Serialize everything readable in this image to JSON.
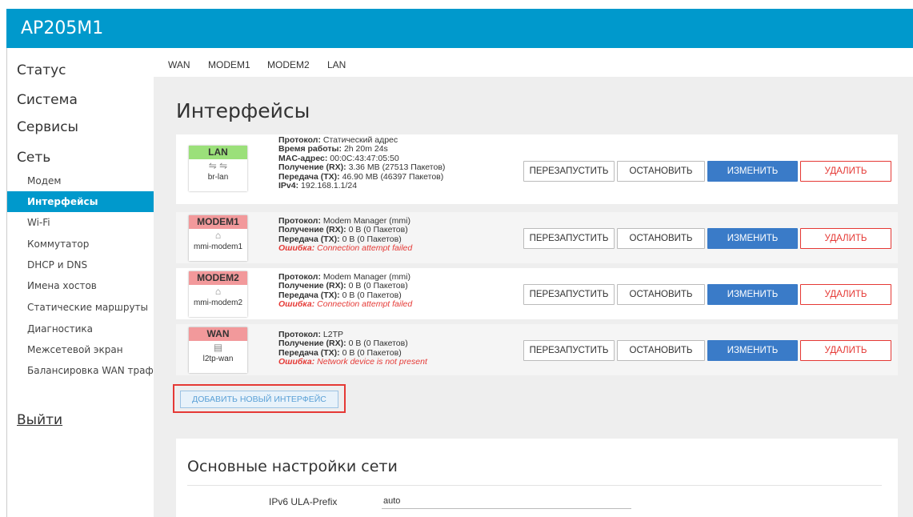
{
  "app_title": "AP205M1",
  "sidebar": {
    "main": [
      {
        "label": "Статус"
      },
      {
        "label": "Система"
      },
      {
        "label": "Сервисы"
      },
      {
        "label": "Сеть"
      }
    ],
    "sub": [
      {
        "label": "Модем"
      },
      {
        "label": "Интерфейсы"
      },
      {
        "label": "Wi-Fi"
      },
      {
        "label": "Коммутатор"
      },
      {
        "label": "DHCP и DNS"
      },
      {
        "label": "Имена хостов"
      },
      {
        "label": "Статические маршруты"
      },
      {
        "label": "Диагностика"
      },
      {
        "label": "Межсетевой экран"
      },
      {
        "label": "Балансировка WAN трафика"
      }
    ],
    "logout": "Выйти"
  },
  "tabs": [
    "WAN",
    "MODEM1",
    "MODEM2",
    "LAN"
  ],
  "page_title": "Интерфейсы",
  "labels": {
    "protocol": "Протокол:",
    "uptime": "Время работы:",
    "mac": "MAC-адрес:",
    "rx": "Получение (RX):",
    "tx": "Передача (TX):",
    "ipv4": "IPv4:",
    "error": "Ошибка:"
  },
  "buttons": {
    "restart": "ПЕРЕЗАПУСТИТЬ",
    "stop": "ОСТАНОВИТЬ",
    "edit": "ИЗМЕНИТЬ",
    "delete": "УДАЛИТЬ"
  },
  "interfaces": [
    {
      "name": "LAN",
      "color": "#9be07a",
      "icon": "bridge-icon",
      "device": "br-lan",
      "protocol": "Статический адрес",
      "uptime": "2h 20m 24s",
      "mac": "00:0C:43:47:05:50",
      "rx": "3.36 MB (27513 Пакетов)",
      "tx": "46.90 MB (46397 Пакетов)",
      "ipv4": "192.168.1.1/24"
    },
    {
      "name": "MODEM1",
      "color": "#f2999b",
      "icon": "ethernet-icon",
      "device": "mmi-modem1",
      "protocol": "Modem Manager (mmi)",
      "rx": "0 B (0 Пакетов)",
      "tx": "0 B (0 Пакетов)",
      "error": "Connection attempt failed"
    },
    {
      "name": "MODEM2",
      "color": "#f2999b",
      "icon": "ethernet-icon",
      "device": "mmi-modem2",
      "protocol": "Modem Manager (mmi)",
      "rx": "0 B (0 Пакетов)",
      "tx": "0 B (0 Пакетов)",
      "error": "Connection attempt failed"
    },
    {
      "name": "WAN",
      "color": "#f2999b",
      "icon": "tunnel-icon",
      "device": "l2tp-wan",
      "protocol": "L2TP",
      "rx": "0 B (0 Пакетов)",
      "tx": "0 B (0 Пакетов)",
      "error": "Network device is not present"
    }
  ],
  "add_button": "ДОБАВИТЬ НОВЫЙ ИНТЕРФЕЙС",
  "global": {
    "title": "Основные настройки сети",
    "ipv6_label": "IPv6 ULA-Prefix",
    "ipv6_value": "auto"
  }
}
